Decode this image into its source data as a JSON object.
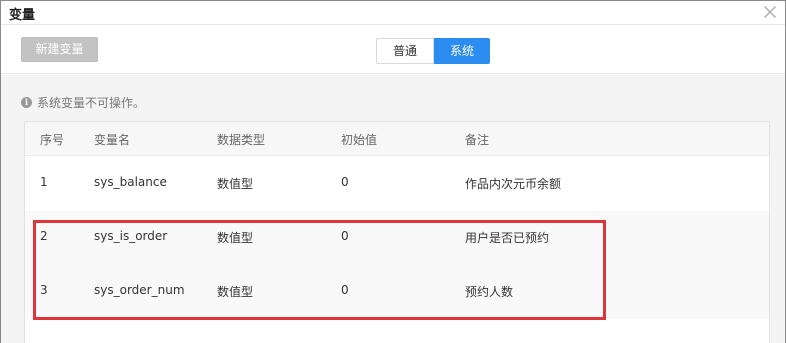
{
  "dialog": {
    "title": "变量",
    "close_icon": "close-icon"
  },
  "toolbar": {
    "new_button_label": "新建变量",
    "tabs": [
      {
        "label": "普通",
        "active": false
      },
      {
        "label": "系统",
        "active": true
      }
    ]
  },
  "notice": {
    "icon": "info-icon",
    "icon_glyph": "i",
    "text": "系统变量不可操作。"
  },
  "table": {
    "columns": [
      "序号",
      "变量名",
      "数据类型",
      "初始值",
      "备注"
    ],
    "rows": [
      [
        "1",
        "sys_balance",
        "数值型",
        "0",
        "作品内次元币余额"
      ],
      [
        "2",
        "sys_is_order",
        "数值型",
        "0",
        "用户是否已预约"
      ],
      [
        "3",
        "sys_order_num",
        "数值型",
        "0",
        "预约人数"
      ]
    ]
  },
  "colors": {
    "accent": "#2d8cf0",
    "highlight": "#e0343b",
    "disabled_button": "#c3c3c3"
  }
}
